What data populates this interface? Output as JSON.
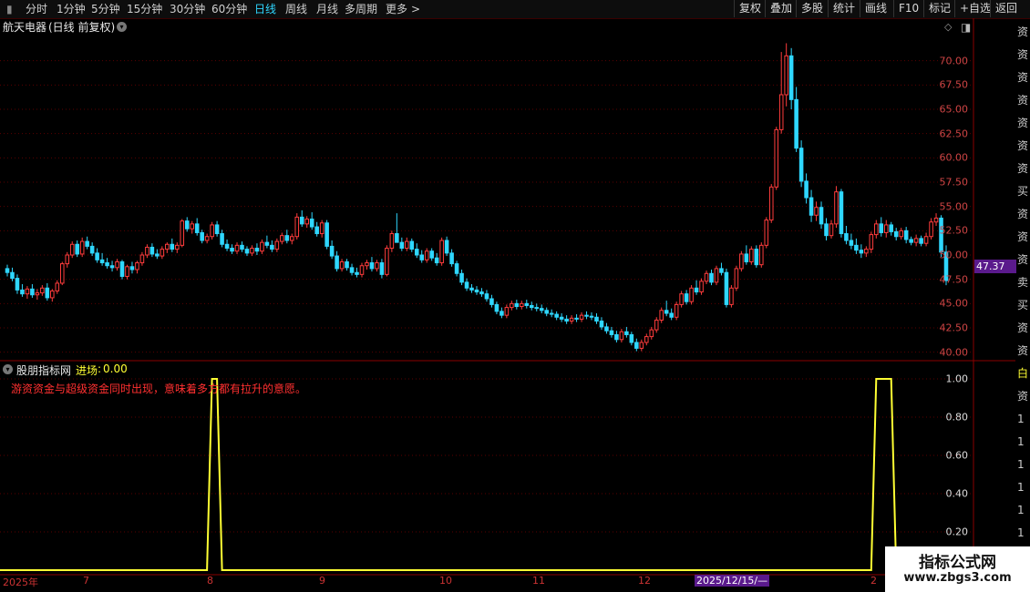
{
  "toolbar": {
    "periods": [
      {
        "label": "分时"
      },
      {
        "label": "1分钟"
      },
      {
        "label": "5分钟"
      },
      {
        "label": "15分钟"
      },
      {
        "label": "30分钟"
      },
      {
        "label": "60分钟"
      },
      {
        "label": "日线",
        "active": true
      },
      {
        "label": "周线"
      },
      {
        "label": "月线"
      },
      {
        "label": "多周期"
      },
      {
        "label": "更多"
      }
    ],
    "tools": [
      {
        "label": "复权"
      },
      {
        "label": "叠加"
      },
      {
        "label": "多股"
      },
      {
        "label": "统计"
      },
      {
        "label": "画线"
      },
      {
        "label": "F10"
      },
      {
        "label": "标记"
      },
      {
        "label": "+自选"
      },
      {
        "label": "返回"
      }
    ]
  },
  "stock": {
    "name": "航天电器",
    "mode": "(日线 前复权)"
  },
  "price_axis": [
    "70.00",
    "67.50",
    "65.00",
    "62.50",
    "60.00",
    "57.50",
    "55.00",
    "52.50",
    "50.00",
    "47.50",
    "45.00",
    "42.50",
    "40.00"
  ],
  "last_price": "47.37",
  "indicator": {
    "source": "股朋指标网",
    "name": "进场",
    "value": "0.00",
    "message": "游资资金与超级资金同时出现，意味着多方都有拉升的意愿。",
    "axis": [
      "1.00",
      "0.80",
      "0.60",
      "0.40",
      "0.20"
    ]
  },
  "time_axis": [
    {
      "label": "2025年"
    },
    {
      "label": "7"
    },
    {
      "label": "8"
    },
    {
      "label": "9"
    },
    {
      "label": "10"
    },
    {
      "label": "11"
    },
    {
      "label": "12"
    },
    {
      "label": "2025/12/15/—",
      "highlight": true
    },
    {
      "label": "2"
    }
  ],
  "side_text": [
    "资",
    "资",
    "资",
    "资",
    "资",
    "资",
    "资",
    "买",
    "资",
    "资",
    "资",
    "卖",
    "买",
    "资",
    "资",
    "白",
    "资",
    "1",
    "1",
    "1",
    "1",
    "1",
    "1",
    "1"
  ],
  "watermark": {
    "title": "指标公式网",
    "url": "www.zbgs3.com"
  },
  "colors": {
    "up": "#ff3c3c",
    "down": "#2fd7ff",
    "signal": "#ffff33",
    "grid": "#5a0000"
  },
  "chart_data": {
    "type": "candlestick",
    "candles": [
      [
        48.6,
        49.0,
        47.8,
        48.2
      ],
      [
        48.2,
        48.7,
        47.3,
        47.6
      ],
      [
        47.6,
        48.0,
        46.0,
        46.4
      ],
      [
        46.4,
        47.0,
        45.7,
        46.0
      ],
      [
        46.0,
        46.8,
        45.5,
        46.5
      ],
      [
        46.5,
        47.0,
        45.6,
        45.9
      ],
      [
        45.9,
        46.5,
        45.4,
        46.1
      ],
      [
        46.1,
        46.9,
        45.8,
        46.6
      ],
      [
        46.6,
        47.1,
        45.3,
        45.6
      ],
      [
        45.6,
        46.5,
        45.2,
        46.3
      ],
      [
        46.3,
        47.4,
        46.0,
        47.1
      ],
      [
        47.1,
        49.3,
        46.9,
        49.1
      ],
      [
        49.1,
        50.3,
        48.7,
        50.0
      ],
      [
        50.0,
        51.4,
        49.7,
        51.1
      ],
      [
        51.1,
        51.5,
        49.8,
        50.1
      ],
      [
        50.1,
        51.8,
        49.8,
        51.4
      ],
      [
        51.4,
        51.9,
        50.6,
        50.9
      ],
      [
        50.9,
        51.3,
        49.9,
        50.2
      ],
      [
        50.2,
        50.7,
        49.2,
        49.5
      ],
      [
        49.5,
        50.2,
        48.9,
        49.2
      ],
      [
        49.2,
        49.7,
        48.6,
        48.9
      ],
      [
        48.9,
        49.4,
        48.3,
        48.7
      ],
      [
        48.7,
        49.6,
        48.4,
        49.3
      ],
      [
        49.3,
        49.5,
        47.5,
        47.8
      ],
      [
        47.8,
        49.0,
        47.5,
        48.8
      ],
      [
        48.8,
        49.3,
        48.1,
        48.5
      ],
      [
        48.5,
        49.4,
        48.1,
        49.2
      ],
      [
        49.2,
        50.3,
        48.9,
        50.0
      ],
      [
        50.0,
        51.1,
        49.7,
        50.8
      ],
      [
        50.8,
        51.2,
        49.8,
        50.1
      ],
      [
        50.1,
        50.6,
        49.6,
        49.9
      ],
      [
        49.9,
        50.9,
        49.6,
        50.6
      ],
      [
        50.6,
        51.3,
        50.2,
        51.1
      ],
      [
        51.1,
        51.7,
        50.3,
        50.6
      ],
      [
        50.6,
        51.3,
        50.2,
        51.0
      ],
      [
        51.0,
        53.7,
        50.8,
        53.5
      ],
      [
        53.5,
        53.9,
        52.4,
        52.7
      ],
      [
        52.7,
        53.5,
        52.2,
        53.2
      ],
      [
        53.2,
        53.8,
        52.0,
        52.3
      ],
      [
        52.3,
        52.6,
        51.2,
        51.5
      ],
      [
        51.5,
        52.2,
        51.2,
        51.9
      ],
      [
        51.9,
        53.4,
        51.6,
        53.1
      ],
      [
        53.1,
        53.5,
        51.9,
        52.2
      ],
      [
        52.2,
        52.6,
        50.8,
        51.1
      ],
      [
        51.1,
        51.6,
        50.4,
        50.7
      ],
      [
        50.7,
        51.1,
        50.1,
        50.4
      ],
      [
        50.4,
        51.3,
        50.1,
        51.0
      ],
      [
        51.0,
        51.4,
        50.3,
        50.6
      ],
      [
        50.6,
        50.9,
        49.9,
        50.2
      ],
      [
        50.2,
        51.0,
        49.9,
        50.7
      ],
      [
        50.7,
        51.2,
        50.0,
        50.4
      ],
      [
        50.4,
        51.6,
        50.1,
        51.3
      ],
      [
        51.3,
        52.0,
        50.7,
        51.0
      ],
      [
        51.0,
        51.5,
        50.3,
        50.6
      ],
      [
        50.6,
        51.7,
        50.3,
        51.4
      ],
      [
        51.4,
        52.3,
        51.1,
        52.0
      ],
      [
        52.0,
        52.6,
        51.2,
        51.5
      ],
      [
        51.5,
        52.2,
        51.1,
        51.9
      ],
      [
        51.9,
        54.3,
        51.6,
        53.9
      ],
      [
        53.9,
        54.6,
        52.9,
        53.2
      ],
      [
        53.2,
        54.0,
        52.8,
        53.7
      ],
      [
        53.7,
        54.4,
        52.6,
        52.9
      ],
      [
        52.9,
        53.4,
        51.9,
        52.2
      ],
      [
        52.2,
        53.6,
        51.8,
        53.3
      ],
      [
        53.3,
        53.6,
        50.6,
        50.9
      ],
      [
        50.9,
        51.5,
        49.6,
        49.9
      ],
      [
        49.9,
        50.4,
        48.3,
        48.6
      ],
      [
        48.6,
        49.6,
        48.3,
        49.3
      ],
      [
        49.3,
        49.6,
        48.4,
        48.7
      ],
      [
        48.7,
        49.1,
        47.9,
        48.2
      ],
      [
        48.2,
        48.7,
        47.7,
        48.0
      ],
      [
        48.0,
        49.2,
        47.7,
        48.9
      ],
      [
        48.9,
        49.5,
        48.5,
        49.2
      ],
      [
        49.2,
        49.8,
        48.3,
        48.6
      ],
      [
        48.6,
        49.5,
        48.3,
        49.2
      ],
      [
        49.2,
        49.6,
        47.6,
        48.0
      ],
      [
        48.0,
        51.0,
        47.8,
        50.7
      ],
      [
        50.7,
        52.5,
        50.3,
        52.2
      ],
      [
        52.2,
        54.3,
        51.9,
        51.3
      ],
      [
        51.3,
        51.8,
        50.4,
        50.7
      ],
      [
        50.7,
        51.8,
        50.4,
        51.4
      ],
      [
        51.4,
        51.7,
        50.3,
        50.6
      ],
      [
        50.6,
        51.2,
        49.7,
        50.0
      ],
      [
        50.0,
        50.5,
        49.2,
        49.5
      ],
      [
        49.5,
        50.7,
        49.2,
        50.4
      ],
      [
        50.4,
        50.7,
        49.4,
        49.7
      ],
      [
        49.7,
        50.2,
        48.9,
        49.2
      ],
      [
        49.2,
        51.8,
        48.9,
        51.5
      ],
      [
        51.5,
        51.9,
        49.9,
        50.2
      ],
      [
        50.2,
        50.6,
        48.8,
        49.1
      ],
      [
        49.1,
        49.4,
        47.8,
        48.1
      ],
      [
        48.1,
        48.5,
        46.9,
        47.2
      ],
      [
        47.2,
        47.6,
        46.3,
        46.6
      ],
      [
        46.6,
        47.0,
        46.1,
        46.4
      ],
      [
        46.4,
        46.8,
        45.9,
        46.2
      ],
      [
        46.2,
        46.6,
        45.7,
        46.0
      ],
      [
        46.0,
        46.4,
        45.2,
        45.5
      ],
      [
        45.5,
        45.9,
        44.6,
        44.9
      ],
      [
        44.9,
        45.2,
        43.9,
        44.2
      ],
      [
        44.2,
        44.6,
        43.5,
        43.8
      ],
      [
        43.8,
        44.9,
        43.5,
        44.6
      ],
      [
        44.6,
        45.3,
        44.3,
        45.0
      ],
      [
        45.0,
        45.4,
        44.4,
        44.7
      ],
      [
        44.7,
        45.3,
        44.4,
        45.0
      ],
      [
        45.0,
        45.4,
        44.5,
        44.8
      ],
      [
        44.8,
        45.2,
        44.3,
        44.6
      ],
      [
        44.6,
        45.0,
        44.2,
        44.5
      ],
      [
        44.5,
        44.9,
        44.0,
        44.3
      ],
      [
        44.3,
        44.6,
        43.7,
        44.0
      ],
      [
        44.0,
        44.4,
        43.6,
        43.9
      ],
      [
        43.9,
        44.2,
        43.3,
        43.6
      ],
      [
        43.6,
        44.0,
        43.1,
        43.4
      ],
      [
        43.4,
        43.8,
        42.9,
        43.2
      ],
      [
        43.2,
        43.8,
        42.9,
        43.5
      ],
      [
        43.5,
        43.9,
        43.1,
        43.4
      ],
      [
        43.4,
        44.1,
        43.1,
        43.8
      ],
      [
        43.8,
        44.2,
        43.4,
        43.7
      ],
      [
        43.7,
        44.1,
        43.3,
        43.6
      ],
      [
        43.6,
        44.0,
        42.9,
        43.2
      ],
      [
        43.2,
        43.6,
        42.3,
        42.6
      ],
      [
        42.6,
        43.0,
        41.9,
        42.2
      ],
      [
        42.2,
        42.6,
        41.5,
        41.8
      ],
      [
        41.8,
        42.2,
        41.0,
        41.3
      ],
      [
        41.3,
        42.4,
        41.0,
        42.1
      ],
      [
        42.1,
        42.6,
        41.5,
        41.8
      ],
      [
        41.8,
        42.1,
        40.7,
        41.0
      ],
      [
        41.0,
        41.4,
        40.1,
        40.4
      ],
      [
        40.4,
        41.3,
        40.1,
        41.0
      ],
      [
        41.0,
        41.9,
        40.7,
        41.6
      ],
      [
        41.6,
        42.6,
        41.3,
        42.3
      ],
      [
        42.3,
        43.6,
        42.0,
        43.3
      ],
      [
        43.3,
        44.6,
        43.0,
        44.3
      ],
      [
        44.3,
        45.3,
        43.7,
        44.0
      ],
      [
        44.0,
        44.5,
        43.3,
        43.6
      ],
      [
        43.6,
        45.2,
        43.3,
        44.9
      ],
      [
        44.9,
        46.3,
        44.6,
        46.0
      ],
      [
        46.0,
        46.4,
        44.9,
        45.2
      ],
      [
        45.2,
        46.9,
        44.9,
        46.6
      ],
      [
        46.6,
        47.4,
        45.9,
        46.2
      ],
      [
        46.2,
        47.6,
        45.9,
        47.3
      ],
      [
        47.3,
        48.4,
        47.0,
        48.1
      ],
      [
        48.1,
        48.5,
        46.9,
        47.2
      ],
      [
        47.2,
        48.9,
        46.9,
        48.6
      ],
      [
        48.6,
        49.2,
        47.9,
        48.2
      ],
      [
        48.2,
        48.6,
        44.6,
        44.9
      ],
      [
        44.9,
        46.9,
        44.6,
        46.6
      ],
      [
        46.6,
        48.9,
        46.3,
        48.6
      ],
      [
        48.6,
        50.4,
        48.3,
        50.1
      ],
      [
        50.1,
        51.0,
        49.0,
        49.3
      ],
      [
        49.3,
        50.9,
        49.0,
        50.6
      ],
      [
        50.6,
        51.0,
        48.7,
        49.0
      ],
      [
        49.0,
        51.3,
        48.7,
        51.0
      ],
      [
        51.0,
        53.9,
        50.7,
        53.6
      ],
      [
        53.6,
        57.3,
        53.3,
        57.0
      ],
      [
        57.0,
        63.2,
        56.7,
        62.9
      ],
      [
        62.9,
        70.9,
        62.5,
        66.5
      ],
      [
        66.5,
        71.8,
        65.3,
        70.5
      ],
      [
        70.5,
        71.3,
        65.0,
        66.0
      ],
      [
        66.0,
        67.3,
        60.6,
        61.0
      ],
      [
        61.0,
        61.8,
        57.0,
        57.6
      ],
      [
        57.6,
        58.4,
        55.3,
        55.9
      ],
      [
        55.9,
        56.7,
        53.4,
        54.1
      ],
      [
        54.1,
        55.5,
        53.5,
        54.9
      ],
      [
        54.9,
        55.5,
        52.7,
        53.2
      ],
      [
        53.2,
        53.8,
        51.5,
        52.0
      ],
      [
        52.0,
        53.6,
        51.7,
        53.2
      ],
      [
        53.2,
        57.1,
        52.8,
        56.5
      ],
      [
        56.5,
        56.8,
        51.8,
        52.2
      ],
      [
        52.2,
        53.0,
        51.1,
        51.5
      ],
      [
        51.5,
        52.2,
        50.6,
        51.0
      ],
      [
        51.0,
        51.7,
        50.1,
        50.5
      ],
      [
        50.5,
        51.1,
        49.7,
        50.2
      ],
      [
        50.2,
        50.9,
        49.8,
        50.6
      ],
      [
        50.6,
        52.4,
        50.2,
        52.1
      ],
      [
        52.1,
        53.6,
        51.7,
        53.2
      ],
      [
        53.2,
        53.9,
        51.9,
        52.3
      ],
      [
        52.3,
        53.6,
        51.8,
        53.1
      ],
      [
        53.1,
        53.4,
        52.0,
        52.4
      ],
      [
        52.4,
        52.8,
        51.5,
        51.9
      ],
      [
        51.9,
        52.8,
        51.6,
        52.5
      ],
      [
        52.5,
        52.9,
        51.2,
        51.6
      ],
      [
        51.6,
        51.9,
        51.0,
        51.3
      ],
      [
        51.3,
        52.1,
        50.9,
        51.7
      ],
      [
        51.7,
        52.0,
        50.9,
        51.2
      ],
      [
        51.2,
        52.3,
        50.9,
        51.9
      ],
      [
        51.9,
        53.8,
        51.6,
        53.4
      ],
      [
        53.4,
        54.3,
        53.0,
        53.8
      ],
      [
        53.8,
        54.1,
        49.8,
        50.3
      ],
      [
        50.3,
        51.0,
        46.9,
        47.37
      ]
    ],
    "signal_spikes": [
      {
        "label": "8",
        "bars": [
          41,
          42
        ]
      },
      {
        "label": "2025/12/15",
        "bars": [
          174,
          175,
          176,
          177
        ]
      }
    ],
    "y_range": [
      39.5,
      72.5
    ],
    "signal_range": [
      0,
      1
    ]
  }
}
